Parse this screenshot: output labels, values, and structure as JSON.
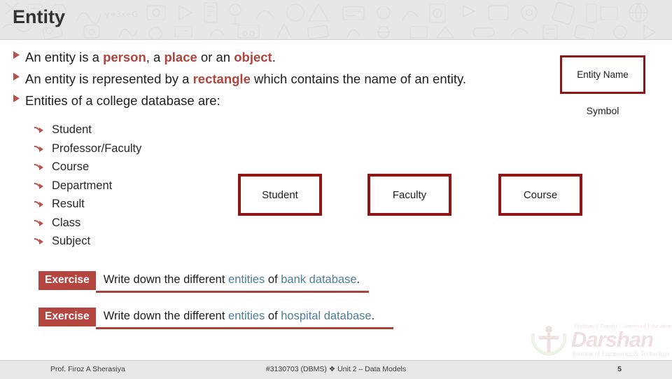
{
  "header": {
    "title": "Entity"
  },
  "bullets": [
    {
      "marker": "triangle-right-icon",
      "parts": [
        {
          "text": "An entity is a ",
          "style": "normal"
        },
        {
          "text": "person",
          "style": "highlight"
        },
        {
          "text": ", a ",
          "style": "normal"
        },
        {
          "text": "place",
          "style": "highlight"
        },
        {
          "text": " or an ",
          "style": "normal"
        },
        {
          "text": "object",
          "style": "highlight"
        },
        {
          "text": ".",
          "style": "normal"
        }
      ]
    },
    {
      "marker": "triangle-right-icon",
      "parts": [
        {
          "text": "An entity is represented by a ",
          "style": "normal"
        },
        {
          "text": "rectangle",
          "style": "highlight"
        },
        {
          "text": "  which contains the name of an entity.",
          "style": "normal"
        }
      ]
    },
    {
      "marker": "triangle-right-icon",
      "parts": [
        {
          "text": "Entities of a college database are:",
          "style": "normal"
        }
      ]
    }
  ],
  "sublist": {
    "marker": "curved-arrow-icon",
    "items": [
      "Student",
      "Professor/Faculty",
      "Course",
      "Department",
      "Result",
      "Class",
      "Subject"
    ]
  },
  "symbol": {
    "box_label": "Entity Name",
    "caption": "Symbol"
  },
  "entity_boxes": [
    {
      "label": "Student"
    },
    {
      "label": "Faculty"
    },
    {
      "label": "Course"
    }
  ],
  "exercises": [
    {
      "badge": "Exercise",
      "parts": [
        {
          "text": "Write down the different ",
          "style": "normal"
        },
        {
          "text": "entities",
          "style": "term"
        },
        {
          "text": " of ",
          "style": "normal"
        },
        {
          "text": "bank database",
          "style": "term"
        },
        {
          "text": ".",
          "style": "normal"
        }
      ]
    },
    {
      "badge": "Exercise",
      "parts": [
        {
          "text": "Write down the different ",
          "style": "normal"
        },
        {
          "text": "entities",
          "style": "term"
        },
        {
          "text": " of ",
          "style": "normal"
        },
        {
          "text": "hospital database",
          "style": "term"
        },
        {
          "text": ".",
          "style": "normal"
        }
      ]
    }
  ],
  "logo": {
    "tagline_top": "Dedicated Faculty Committed Education",
    "word": "Darshan",
    "tagline_bottom": "Institute of Engineering & Technology"
  },
  "footer": {
    "author": "Prof. Firoz A Sherasiya",
    "center": "#3130703 (DBMS)  ❖  Unit 2 – Data Models",
    "page": "5"
  },
  "colors": {
    "accent_red": "#b0443f",
    "box_border_red": "#8e1616",
    "badge_red": "#b4453f",
    "term_blue": "#4d7e96",
    "header_bg": "#e6e6e6",
    "footer_bg": "#e8e8e8"
  }
}
